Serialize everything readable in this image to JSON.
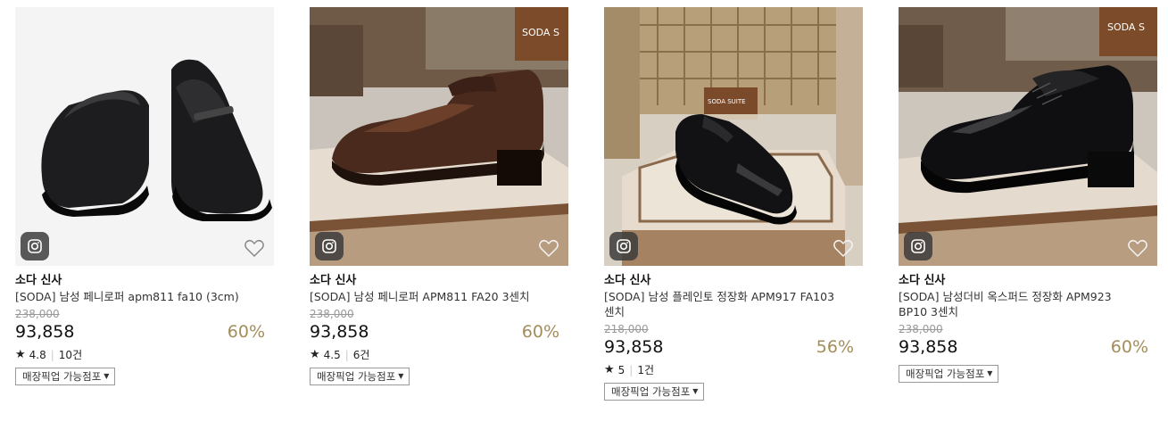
{
  "products": [
    {
      "brand": "소다 신사",
      "title": "[SODA] 남성 페니로퍼 apm811 fa10 (3cm)",
      "original_price": "238,000",
      "price": "93,858",
      "discount": "60%",
      "rating": "4.8",
      "reviews": "10건",
      "pickup_label": "매장픽업 가능점포",
      "image_alt": "black penny loafers pair"
    },
    {
      "brand": "소다 신사",
      "title": "[SODA] 남성 페니로퍼 APM811 FA20 3센치",
      "original_price": "238,000",
      "price": "93,858",
      "discount": "60%",
      "rating": "4.5",
      "reviews": "6건",
      "pickup_label": "매장픽업 가능점포",
      "image_alt": "brown penny loafer on display"
    },
    {
      "brand": "소다 신사",
      "title": "[SODA] 남성 플레인토 정장화 APM917 FA103 센치",
      "original_price": "218,000",
      "price": "93,858",
      "discount": "56%",
      "rating": "5",
      "reviews": "1건",
      "pickup_label": "매장픽업 가능점포",
      "image_alt": "black plain toe dress shoe on display"
    },
    {
      "brand": "소다 신사",
      "title": "[SODA] 남성더비 옥스퍼드 정장화 APM923 BP10 3센치",
      "original_price": "238,000",
      "price": "93,858",
      "discount": "60%",
      "pickup_label": "매장픽업 가능점포",
      "image_alt": "black derby oxford shoe on display"
    }
  ],
  "display_sign_1": "SODA S",
  "display_sign_2": "SODA SUITE",
  "display_sign_3": "SODA S",
  "colors": {
    "discount": "#a38e5b",
    "price_strike": "#999999"
  },
  "icons": {
    "instagram": "instagram-icon",
    "wishlist": "heart-icon",
    "rating": "star-icon",
    "dropdown": "caret-down-icon"
  }
}
